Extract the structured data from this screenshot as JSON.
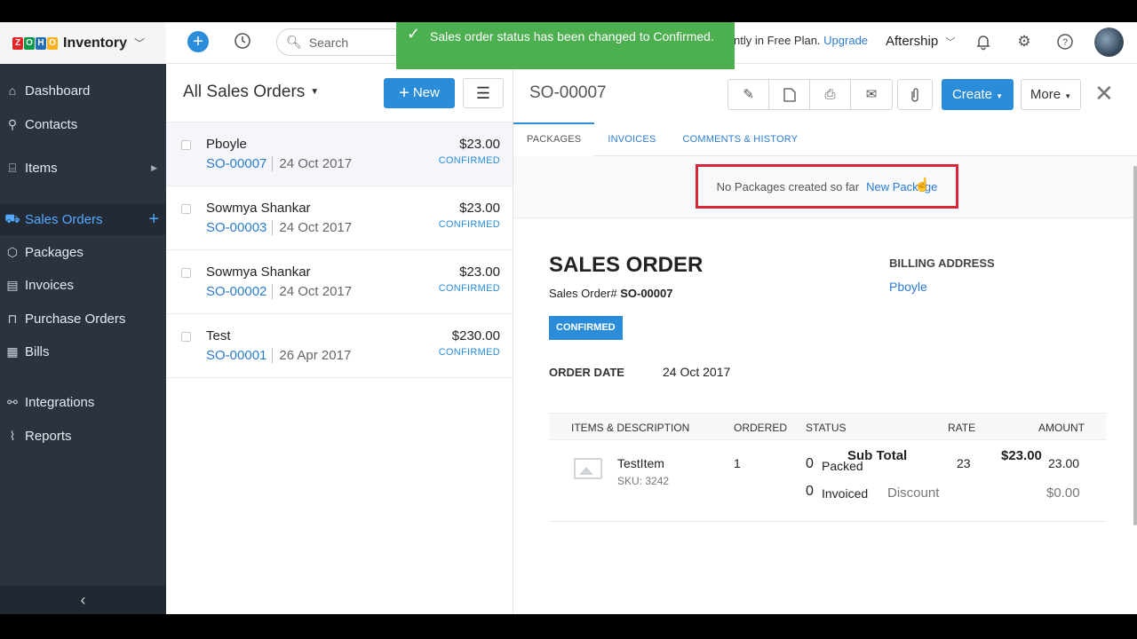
{
  "app": {
    "logo_letters": [
      "Z",
      "O",
      "H",
      "O"
    ],
    "logo_colors": [
      "#e42527",
      "#089949",
      "#226db4",
      "#f9b21d"
    ],
    "name": "Inventory"
  },
  "topbar": {
    "search_placeholder": "Search",
    "plan_text": "ntly in Free Plan.",
    "upgrade_label": "Upgrade",
    "org_name": "Aftership",
    "icons": [
      "add-icon",
      "history-icon",
      "bell-icon",
      "gear-icon",
      "help-icon"
    ]
  },
  "toast": {
    "message": "Sales order status has been changed to Confirmed.",
    "color": "#4caf50"
  },
  "sidebar": {
    "items": [
      {
        "label": "Dashboard",
        "icon": "home-icon"
      },
      {
        "label": "Contacts",
        "icon": "person-icon"
      },
      {
        "label": "Items",
        "icon": "box-icon"
      },
      {
        "label": "Sales Orders",
        "icon": "cart-icon"
      },
      {
        "label": "Packages",
        "icon": "package-icon"
      },
      {
        "label": "Invoices",
        "icon": "invoice-icon"
      },
      {
        "label": "Purchase Orders",
        "icon": "bag-icon"
      },
      {
        "label": "Bills",
        "icon": "bill-icon"
      },
      {
        "label": "Integrations",
        "icon": "plug-icon"
      },
      {
        "label": "Reports",
        "icon": "chart-icon"
      }
    ],
    "active": "Sales Orders"
  },
  "list": {
    "title": "All Sales Orders",
    "new_label": "New",
    "rows": [
      {
        "name": "Pboyle",
        "so": "SO-00007",
        "date": "24 Oct 2017",
        "amount": "$23.00",
        "status": "CONFIRMED"
      },
      {
        "name": "Sowmya Shankar",
        "so": "SO-00003",
        "date": "24 Oct 2017",
        "amount": "$23.00",
        "status": "CONFIRMED"
      },
      {
        "name": "Sowmya Shankar",
        "so": "SO-00002",
        "date": "24 Oct 2017",
        "amount": "$23.00",
        "status": "CONFIRMED"
      },
      {
        "name": "Test",
        "so": "SO-00001",
        "date": "26 Apr 2017",
        "amount": "$230.00",
        "status": "CONFIRMED"
      }
    ]
  },
  "detail": {
    "so_number": "SO-00007",
    "create_label": "Create",
    "more_label": "More",
    "tabs": [
      "PACKAGES",
      "INVOICES",
      "COMMENTS & HISTORY"
    ],
    "no_packages_text": "No Packages created so far",
    "new_package_label": "New Package",
    "doc_title": "SALES ORDER",
    "so_label": "Sales Order#",
    "status": "CONFIRMED",
    "billing_label": "BILLING ADDRESS",
    "billing_name": "Pboyle",
    "order_date_label": "ORDER DATE",
    "order_date": "24 Oct 2017",
    "table_headers": [
      "ITEMS & DESCRIPTION",
      "ORDERED",
      "STATUS",
      "RATE",
      "AMOUNT"
    ],
    "item": {
      "name": "TestItem",
      "sku": "SKU: 3242",
      "ordered": "1",
      "packed_count": "0",
      "packed_label": "Packed",
      "invoiced_count": "0",
      "invoiced_label": "Invoiced",
      "rate": "23",
      "amount": "23.00"
    },
    "subtotal_label": "Sub Total",
    "subtotal": "$23.00",
    "discount_label": "Discount",
    "discount": "$0.00"
  }
}
